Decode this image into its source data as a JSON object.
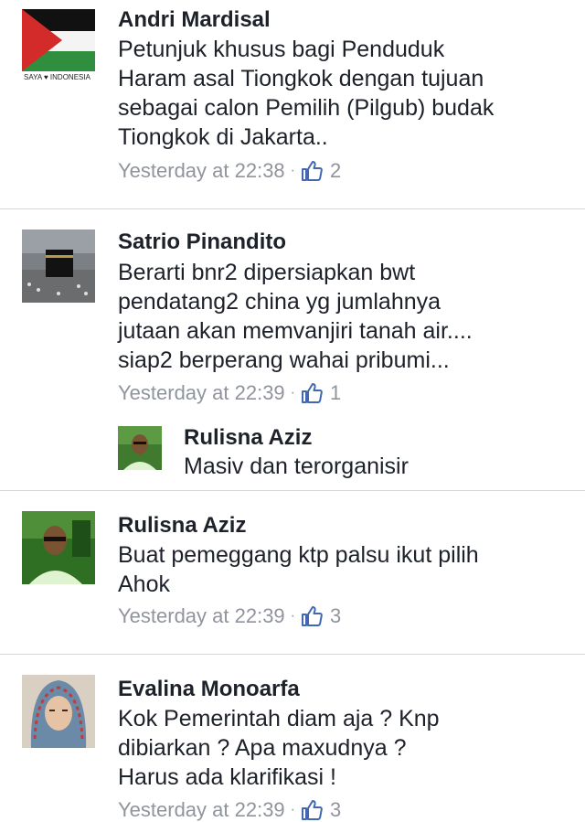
{
  "comments": [
    {
      "author": "Andri Mardisal",
      "avatar_caption": "SAYA ♥ INDONESIA",
      "lines": [
        "Petunjuk khusus bagi Penduduk",
        "Haram asal Tiongkok dengan tujuan",
        "sebagai calon Pemilih (Pilgub) budak",
        "Tiongkok di Jakarta.."
      ],
      "time": "Yesterday at 22:38",
      "likes": "2"
    },
    {
      "author": "Satrio Pinandito",
      "lines": [
        "Berarti bnr2 dipersiapkan bwt",
        "pendatang2 china yg jumlahnya",
        "jutaan akan memvanjiri tanah air....",
        "siap2 berperang wahai pribumi..."
      ],
      "time": "Yesterday at 22:39",
      "likes": "1",
      "reply": {
        "author": "Rulisna Aziz",
        "text": "Masiv dan terorganisir"
      }
    },
    {
      "author": "Rulisna Aziz",
      "lines": [
        "Buat pemeggang ktp palsu ikut pilih",
        "Ahok"
      ],
      "time": "Yesterday at 22:39",
      "likes": "3"
    },
    {
      "author": "Evalina Monoarfa",
      "lines": [
        "Kok Pemerintah diam aja ? Knp",
        "dibiarkan ? Apa maxudnya ?",
        "Harus ada klarifikasi !"
      ],
      "time": "Yesterday at 22:39",
      "likes": "3"
    }
  ],
  "colors": {
    "text": "#1d2129",
    "meta": "#90949c",
    "like_blue": "#4267b2",
    "divider": "#d8d8d8"
  },
  "icons": {
    "like": "thumbs-up-icon"
  }
}
